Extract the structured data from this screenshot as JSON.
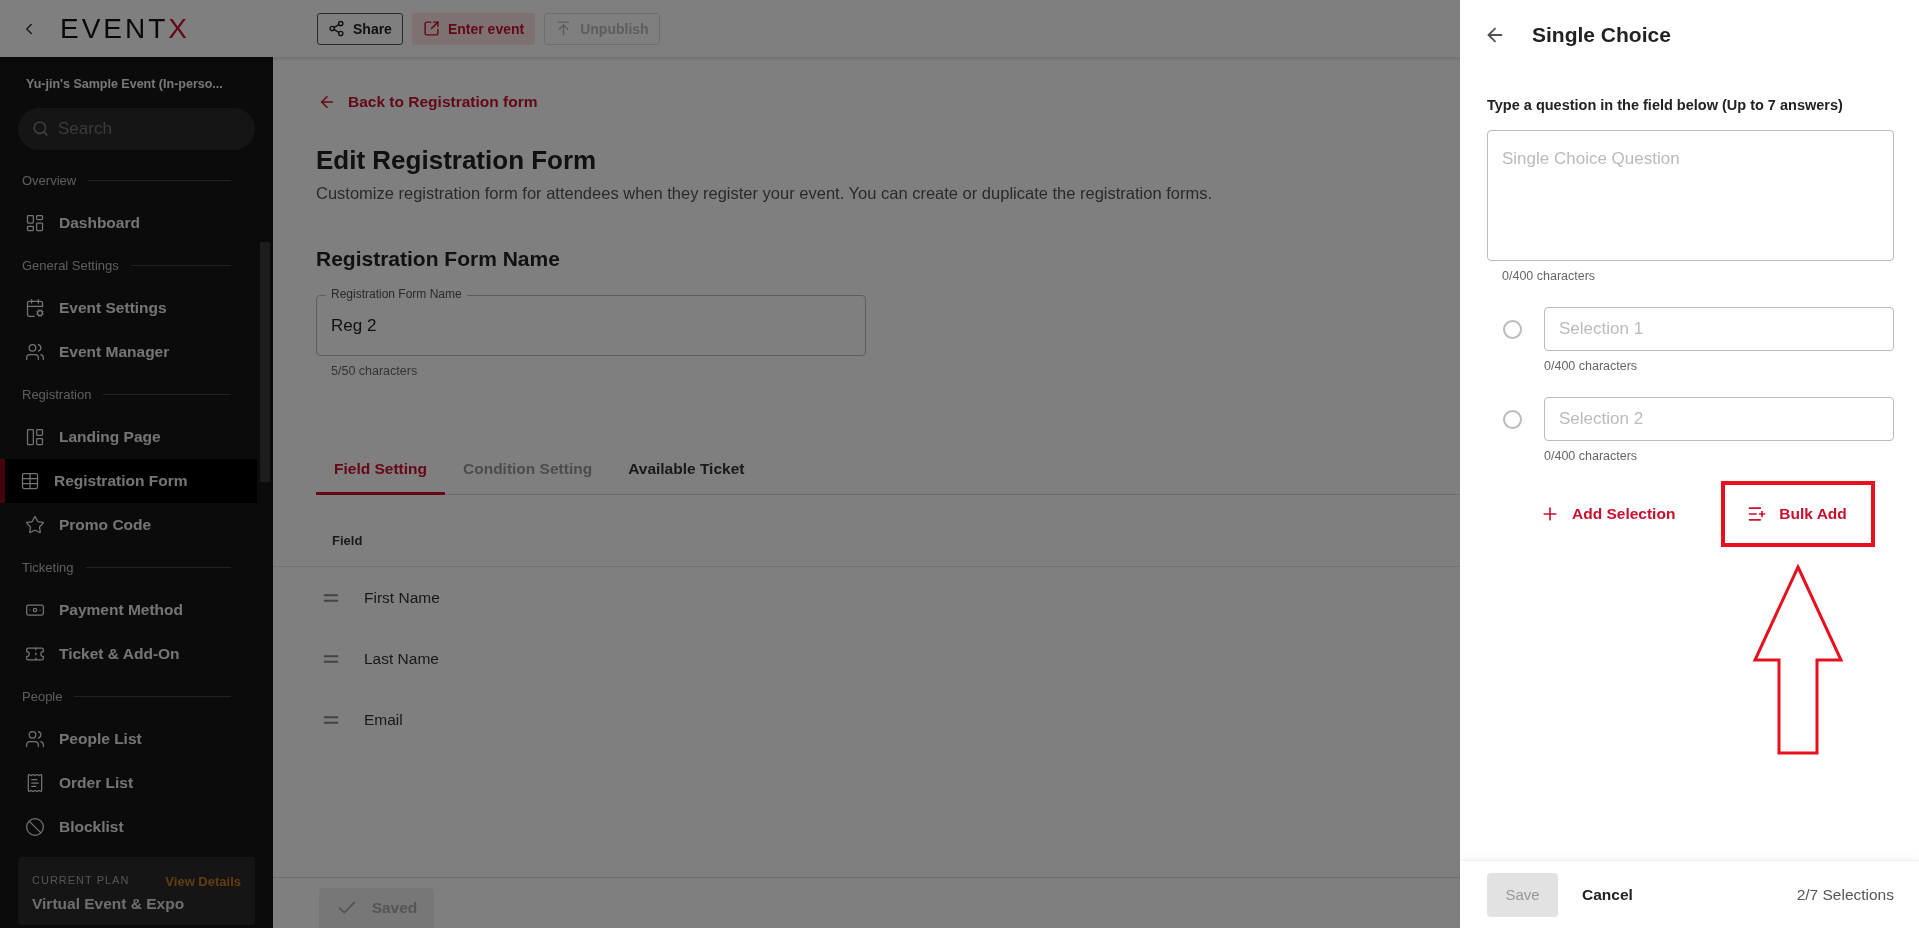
{
  "topbar": {
    "logo": {
      "text": "EVENT",
      "accent": "X"
    },
    "actions": [
      {
        "kind": "share",
        "label": "Share",
        "disabled": false
      },
      {
        "kind": "enter",
        "label": "Enter event",
        "disabled": false
      },
      {
        "kind": "unpublish",
        "label": "Unpublish",
        "disabled": true
      }
    ]
  },
  "sidebar": {
    "event_name": "Yu-jin's Sample Event (In-perso...",
    "search": {
      "placeholder": "Search"
    },
    "sections": [
      {
        "title": "Overview",
        "items": [
          {
            "label": "Dashboard",
            "selected": false
          }
        ]
      },
      {
        "title": "General Settings",
        "items": [
          {
            "label": "Event Settings",
            "selected": false
          },
          {
            "label": "Event Manager",
            "selected": false
          }
        ]
      },
      {
        "title": "Registration",
        "items": [
          {
            "label": "Landing Page",
            "selected": false
          },
          {
            "label": "Registration Form",
            "selected": true
          },
          {
            "label": "Promo Code",
            "selected": false
          }
        ]
      },
      {
        "title": "Ticketing",
        "items": [
          {
            "label": "Payment Method",
            "selected": false
          },
          {
            "label": "Ticket & Add-On",
            "selected": false
          }
        ]
      },
      {
        "title": "People",
        "items": [
          {
            "label": "People List",
            "selected": false
          },
          {
            "label": "Order List",
            "selected": false
          },
          {
            "label": "Blocklist",
            "selected": false
          }
        ]
      }
    ],
    "plan": {
      "caption": "CURRENT PLAN",
      "link": "View Details",
      "name": "Virtual Event & Expo"
    }
  },
  "main": {
    "back_link": "Back to Registration form",
    "title": "Edit Registration Form",
    "description": "Customize registration form for attendees when they register your event. You can create or duplicate the registration forms.",
    "name_section": {
      "heading": "Registration Form Name",
      "field_label": "Registration Form Name",
      "value": "Reg 2",
      "counter": "5/50 characters"
    },
    "tabs": [
      {
        "label": "Field Setting",
        "selected": true,
        "disabled": false
      },
      {
        "label": "Condition Setting",
        "selected": false,
        "disabled": true
      },
      {
        "label": "Available Ticket",
        "selected": false,
        "disabled": false
      }
    ],
    "table": {
      "columns": [
        "Field"
      ],
      "rows": [
        "First Name",
        "Last Name",
        "Email"
      ]
    },
    "footer": {
      "save_label": "Saved",
      "disabled": true
    }
  },
  "drawer": {
    "title": "Single Choice",
    "instruction": "Type a question in the field below (Up to 7 answers)",
    "question": {
      "placeholder": "Single Choice Question",
      "counter": "0/400 characters"
    },
    "selections": [
      {
        "placeholder": "Selection 1",
        "counter": "0/400 characters",
        "selected": false
      },
      {
        "placeholder": "Selection 2",
        "counter": "0/400 characters",
        "selected": false
      }
    ],
    "actions": [
      {
        "kind": "add",
        "label": "Add Selection",
        "highlighted": false
      },
      {
        "kind": "bulk",
        "label": "Bulk Add",
        "highlighted": true
      }
    ],
    "footer": {
      "save": "Save",
      "save_disabled": true,
      "cancel": "Cancel",
      "count": "2/7 Selections"
    }
  }
}
